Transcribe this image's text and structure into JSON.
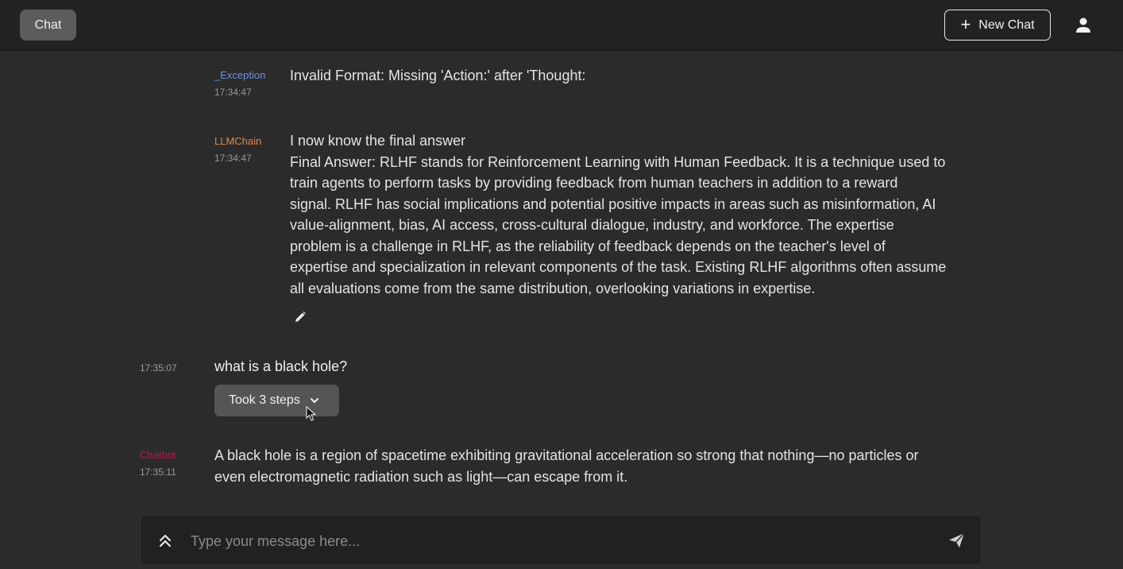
{
  "header": {
    "chat_tab_label": "Chat",
    "new_chat_label": "New Chat"
  },
  "messages": [
    {
      "author": "_Exception",
      "author_color": "#6f8fe0",
      "time": "17:34:47",
      "lines": [
        "Invalid Format: Missing 'Action:' after 'Thought:"
      ]
    },
    {
      "author": "LLMChain",
      "author_color": "#e0894f",
      "time": "17:34:47",
      "lines": [
        "I now know the final answer",
        "Final Answer: RLHF stands for Reinforcement Learning with Human Feedback. It is a technique used to",
        "train agents to perform tasks by providing feedback from human teachers in addition to a reward",
        "signal. RLHF has social implications and potential positive impacts in areas such as misinformation, AI",
        "value-alignment, bias, AI access, cross-cultural dialogue, industry, and workforce. The expertise",
        "problem is a challenge in RLHF, as the reliability of feedback depends on the teacher's level of",
        "expertise and specialization in relevant components of the task. Existing RLHF algorithms often assume",
        "all evaluations come from the same distribution, overlooking variations in expertise."
      ]
    },
    {
      "time": "17:35:07",
      "text": "what is a black hole?",
      "steps_label": "Took 3 steps"
    },
    {
      "author": "Chatbot",
      "author_color": "#c2184a",
      "time": "17:35:11",
      "lines": [
        "A black hole is a region of spacetime exhibiting gravitational acceleration so strong that nothing—no particles or",
        "even electromagnetic radiation such as light—can escape from it."
      ]
    }
  ],
  "composer": {
    "placeholder": "Type your message here..."
  },
  "icons": {
    "plus": "plus-icon",
    "user": "user-icon",
    "pencil": "pencil-icon",
    "chevron": "chevron-down-icon",
    "expand": "double-chevron-up-icon",
    "send": "send-icon"
  }
}
